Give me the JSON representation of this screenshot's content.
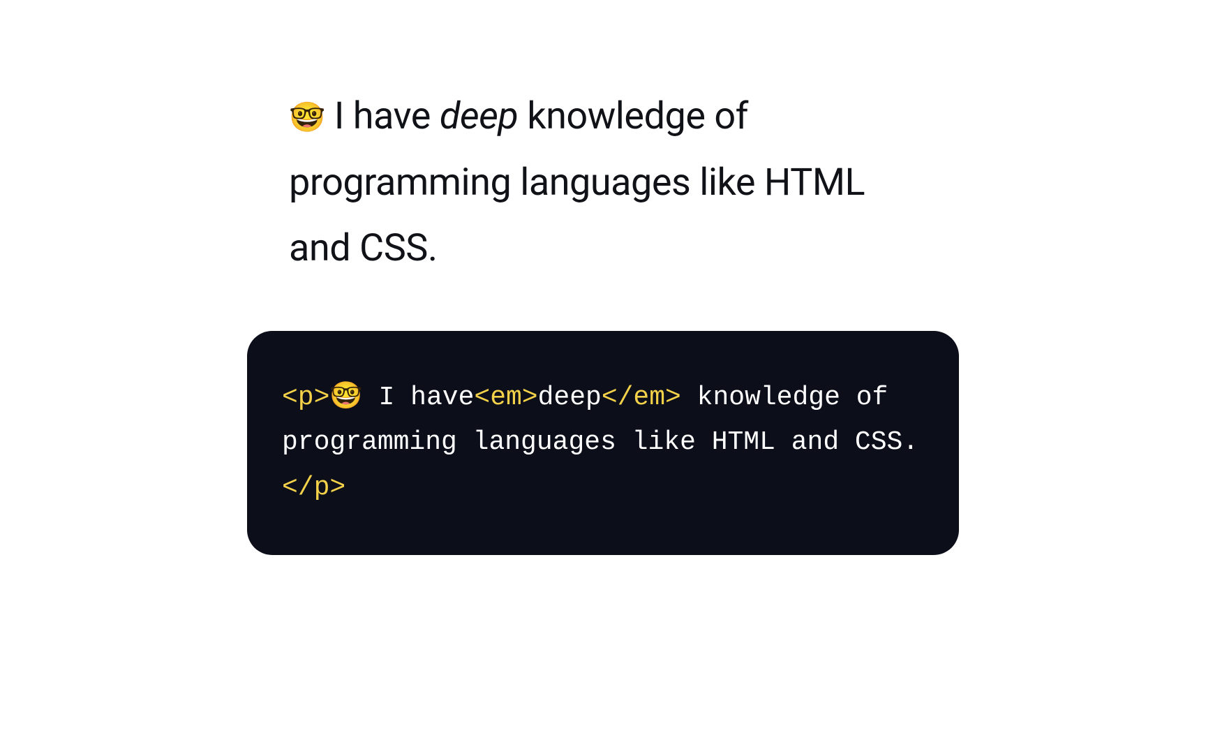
{
  "paragraph": {
    "emoji": "🤓",
    "text_before_em": " I have ",
    "em_text": "deep",
    "text_after_em": " knowledge of programming languages like HTML and CSS."
  },
  "code": {
    "tag_p_open": "<p>",
    "emoji": "🤓",
    "text1": " I have",
    "tag_em_open": "<em>",
    "em_text": "deep",
    "tag_em_close": "</em>",
    "text2": " knowledge of programming languages like HTML and CSS.",
    "tag_p_close": "</p>"
  }
}
